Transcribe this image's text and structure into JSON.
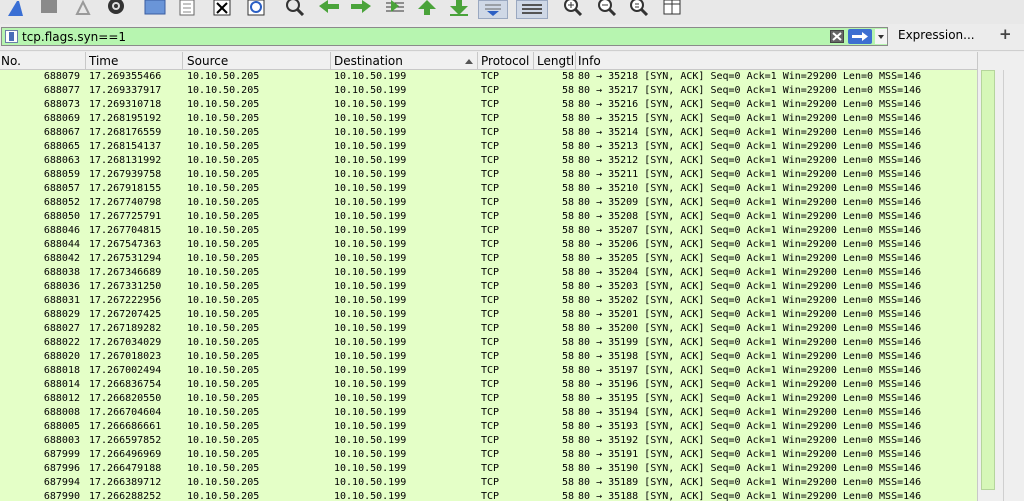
{
  "toolbar": {
    "buttons": [
      {
        "name": "shark-fin-icon",
        "interactable": true
      },
      {
        "name": "stop-capture-icon",
        "interactable": true
      },
      {
        "name": "restart-capture-icon",
        "interactable": true
      },
      {
        "name": "capture-options-gear-icon",
        "interactable": true
      },
      {
        "name": "open-file-icon",
        "interactable": true
      },
      {
        "name": "save-file-icon",
        "interactable": true
      },
      {
        "name": "close-file-icon",
        "interactable": true
      },
      {
        "name": "reload-file-icon",
        "interactable": true
      },
      {
        "name": "find-packet-icon",
        "interactable": true
      },
      {
        "name": "go-back-icon",
        "interactable": true
      },
      {
        "name": "go-forward-icon",
        "interactable": true
      },
      {
        "name": "go-to-packet-icon",
        "interactable": true
      },
      {
        "name": "go-to-first-packet-icon",
        "interactable": true
      },
      {
        "name": "go-to-last-packet-icon",
        "interactable": true
      },
      {
        "name": "auto-scroll-icon",
        "interactable": true
      },
      {
        "name": "colorize-icon",
        "interactable": true
      },
      {
        "name": "zoom-in-icon",
        "interactable": true
      },
      {
        "name": "zoom-out-icon",
        "interactable": true
      },
      {
        "name": "normal-size-icon",
        "interactable": true
      },
      {
        "name": "resize-columns-icon",
        "interactable": true
      }
    ]
  },
  "filter": {
    "value": "tcp.flags.syn==1",
    "expression_label": "Expression...",
    "plus_label": "+",
    "bg_color": "#b7f5b0"
  },
  "columns": {
    "no": "No.",
    "time": "Time",
    "source": "Source",
    "destination": "Destination",
    "protocol": "Protocol",
    "length": "Lengtl",
    "info": "Info"
  },
  "row_bg_color": "#e4ffc7",
  "packets": [
    {
      "no": "688079",
      "time": "17.269355466",
      "src": "10.10.50.205",
      "dst": "10.10.50.199",
      "proto": "TCP",
      "len": "58",
      "info": "80 → 35218 [SYN, ACK] Seq=0 Ack=1 Win=29200 Len=0 MSS=146"
    },
    {
      "no": "688077",
      "time": "17.269337917",
      "src": "10.10.50.205",
      "dst": "10.10.50.199",
      "proto": "TCP",
      "len": "58",
      "info": "80 → 35217 [SYN, ACK] Seq=0 Ack=1 Win=29200 Len=0 MSS=146"
    },
    {
      "no": "688073",
      "time": "17.269310718",
      "src": "10.10.50.205",
      "dst": "10.10.50.199",
      "proto": "TCP",
      "len": "58",
      "info": "80 → 35216 [SYN, ACK] Seq=0 Ack=1 Win=29200 Len=0 MSS=146"
    },
    {
      "no": "688069",
      "time": "17.268195192",
      "src": "10.10.50.205",
      "dst": "10.10.50.199",
      "proto": "TCP",
      "len": "58",
      "info": "80 → 35215 [SYN, ACK] Seq=0 Ack=1 Win=29200 Len=0 MSS=146"
    },
    {
      "no": "688067",
      "time": "17.268176559",
      "src": "10.10.50.205",
      "dst": "10.10.50.199",
      "proto": "TCP",
      "len": "58",
      "info": "80 → 35214 [SYN, ACK] Seq=0 Ack=1 Win=29200 Len=0 MSS=146"
    },
    {
      "no": "688065",
      "time": "17.268154137",
      "src": "10.10.50.205",
      "dst": "10.10.50.199",
      "proto": "TCP",
      "len": "58",
      "info": "80 → 35213 [SYN, ACK] Seq=0 Ack=1 Win=29200 Len=0 MSS=146"
    },
    {
      "no": "688063",
      "time": "17.268131992",
      "src": "10.10.50.205",
      "dst": "10.10.50.199",
      "proto": "TCP",
      "len": "58",
      "info": "80 → 35212 [SYN, ACK] Seq=0 Ack=1 Win=29200 Len=0 MSS=146"
    },
    {
      "no": "688059",
      "time": "17.267939758",
      "src": "10.10.50.205",
      "dst": "10.10.50.199",
      "proto": "TCP",
      "len": "58",
      "info": "80 → 35211 [SYN, ACK] Seq=0 Ack=1 Win=29200 Len=0 MSS=146"
    },
    {
      "no": "688057",
      "time": "17.267918155",
      "src": "10.10.50.205",
      "dst": "10.10.50.199",
      "proto": "TCP",
      "len": "58",
      "info": "80 → 35210 [SYN, ACK] Seq=0 Ack=1 Win=29200 Len=0 MSS=146"
    },
    {
      "no": "688052",
      "time": "17.267740798",
      "src": "10.10.50.205",
      "dst": "10.10.50.199",
      "proto": "TCP",
      "len": "58",
      "info": "80 → 35209 [SYN, ACK] Seq=0 Ack=1 Win=29200 Len=0 MSS=146"
    },
    {
      "no": "688050",
      "time": "17.267725791",
      "src": "10.10.50.205",
      "dst": "10.10.50.199",
      "proto": "TCP",
      "len": "58",
      "info": "80 → 35208 [SYN, ACK] Seq=0 Ack=1 Win=29200 Len=0 MSS=146"
    },
    {
      "no": "688046",
      "time": "17.267704815",
      "src": "10.10.50.205",
      "dst": "10.10.50.199",
      "proto": "TCP",
      "len": "58",
      "info": "80 → 35207 [SYN, ACK] Seq=0 Ack=1 Win=29200 Len=0 MSS=146"
    },
    {
      "no": "688044",
      "time": "17.267547363",
      "src": "10.10.50.205",
      "dst": "10.10.50.199",
      "proto": "TCP",
      "len": "58",
      "info": "80 → 35206 [SYN, ACK] Seq=0 Ack=1 Win=29200 Len=0 MSS=146"
    },
    {
      "no": "688042",
      "time": "17.267531294",
      "src": "10.10.50.205",
      "dst": "10.10.50.199",
      "proto": "TCP",
      "len": "58",
      "info": "80 → 35205 [SYN, ACK] Seq=0 Ack=1 Win=29200 Len=0 MSS=146"
    },
    {
      "no": "688038",
      "time": "17.267346689",
      "src": "10.10.50.205",
      "dst": "10.10.50.199",
      "proto": "TCP",
      "len": "58",
      "info": "80 → 35204 [SYN, ACK] Seq=0 Ack=1 Win=29200 Len=0 MSS=146"
    },
    {
      "no": "688036",
      "time": "17.267331250",
      "src": "10.10.50.205",
      "dst": "10.10.50.199",
      "proto": "TCP",
      "len": "58",
      "info": "80 → 35203 [SYN, ACK] Seq=0 Ack=1 Win=29200 Len=0 MSS=146"
    },
    {
      "no": "688031",
      "time": "17.267222956",
      "src": "10.10.50.205",
      "dst": "10.10.50.199",
      "proto": "TCP",
      "len": "58",
      "info": "80 → 35202 [SYN, ACK] Seq=0 Ack=1 Win=29200 Len=0 MSS=146"
    },
    {
      "no": "688029",
      "time": "17.267207425",
      "src": "10.10.50.205",
      "dst": "10.10.50.199",
      "proto": "TCP",
      "len": "58",
      "info": "80 → 35201 [SYN, ACK] Seq=0 Ack=1 Win=29200 Len=0 MSS=146"
    },
    {
      "no": "688027",
      "time": "17.267189282",
      "src": "10.10.50.205",
      "dst": "10.10.50.199",
      "proto": "TCP",
      "len": "58",
      "info": "80 → 35200 [SYN, ACK] Seq=0 Ack=1 Win=29200 Len=0 MSS=146"
    },
    {
      "no": "688022",
      "time": "17.267034029",
      "src": "10.10.50.205",
      "dst": "10.10.50.199",
      "proto": "TCP",
      "len": "58",
      "info": "80 → 35199 [SYN, ACK] Seq=0 Ack=1 Win=29200 Len=0 MSS=146"
    },
    {
      "no": "688020",
      "time": "17.267018023",
      "src": "10.10.50.205",
      "dst": "10.10.50.199",
      "proto": "TCP",
      "len": "58",
      "info": "80 → 35198 [SYN, ACK] Seq=0 Ack=1 Win=29200 Len=0 MSS=146"
    },
    {
      "no": "688018",
      "time": "17.267002494",
      "src": "10.10.50.205",
      "dst": "10.10.50.199",
      "proto": "TCP",
      "len": "58",
      "info": "80 → 35197 [SYN, ACK] Seq=0 Ack=1 Win=29200 Len=0 MSS=146"
    },
    {
      "no": "688014",
      "time": "17.266836754",
      "src": "10.10.50.205",
      "dst": "10.10.50.199",
      "proto": "TCP",
      "len": "58",
      "info": "80 → 35196 [SYN, ACK] Seq=0 Ack=1 Win=29200 Len=0 MSS=146"
    },
    {
      "no": "688012",
      "time": "17.266820550",
      "src": "10.10.50.205",
      "dst": "10.10.50.199",
      "proto": "TCP",
      "len": "58",
      "info": "80 → 35195 [SYN, ACK] Seq=0 Ack=1 Win=29200 Len=0 MSS=146"
    },
    {
      "no": "688008",
      "time": "17.266704604",
      "src": "10.10.50.205",
      "dst": "10.10.50.199",
      "proto": "TCP",
      "len": "58",
      "info": "80 → 35194 [SYN, ACK] Seq=0 Ack=1 Win=29200 Len=0 MSS=146"
    },
    {
      "no": "688005",
      "time": "17.266686661",
      "src": "10.10.50.205",
      "dst": "10.10.50.199",
      "proto": "TCP",
      "len": "58",
      "info": "80 → 35193 [SYN, ACK] Seq=0 Ack=1 Win=29200 Len=0 MSS=146"
    },
    {
      "no": "688003",
      "time": "17.266597852",
      "src": "10.10.50.205",
      "dst": "10.10.50.199",
      "proto": "TCP",
      "len": "58",
      "info": "80 → 35192 [SYN, ACK] Seq=0 Ack=1 Win=29200 Len=0 MSS=146"
    },
    {
      "no": "687999",
      "time": "17.266496969",
      "src": "10.10.50.205",
      "dst": "10.10.50.199",
      "proto": "TCP",
      "len": "58",
      "info": "80 → 35191 [SYN, ACK] Seq=0 Ack=1 Win=29200 Len=0 MSS=146"
    },
    {
      "no": "687996",
      "time": "17.266479188",
      "src": "10.10.50.205",
      "dst": "10.10.50.199",
      "proto": "TCP",
      "len": "58",
      "info": "80 → 35190 [SYN, ACK] Seq=0 Ack=1 Win=29200 Len=0 MSS=146"
    },
    {
      "no": "687994",
      "time": "17.266389712",
      "src": "10.10.50.205",
      "dst": "10.10.50.199",
      "proto": "TCP",
      "len": "58",
      "info": "80 → 35189 [SYN, ACK] Seq=0 Ack=1 Win=29200 Len=0 MSS=146"
    },
    {
      "no": "687990",
      "time": "17.266288252",
      "src": "10.10.50.205",
      "dst": "10.10.50.199",
      "proto": "TCP",
      "len": "58",
      "info": "80 → 35188 [SYN, ACK] Seq=0 Ack=1 Win=29200 Len=0 MSS=146"
    }
  ]
}
